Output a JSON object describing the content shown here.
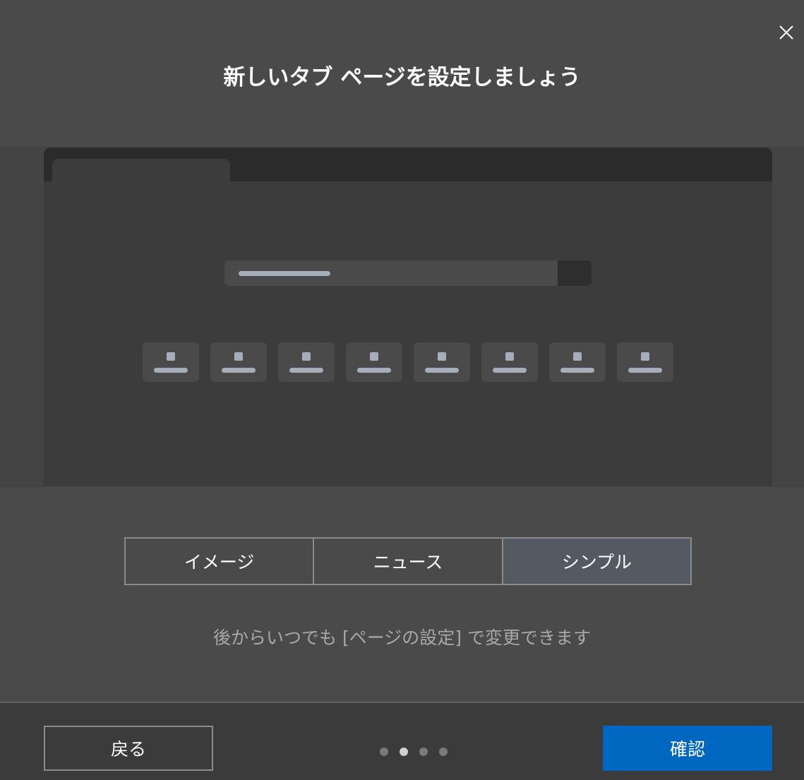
{
  "dialog": {
    "title": "新しいタブ ページを設定しましょう",
    "close_icon": "close-icon"
  },
  "preview": {
    "tile_count": 8
  },
  "layout_options": {
    "options": [
      {
        "label": "イメージ",
        "selected": false
      },
      {
        "label": "ニュース",
        "selected": false
      },
      {
        "label": "シンプル",
        "selected": true
      }
    ]
  },
  "hint": "後からいつでも [ページの設定] で変更できます",
  "footer": {
    "back_label": "戻る",
    "confirm_label": "確認",
    "pager": {
      "total": 4,
      "current": 2
    }
  },
  "colors": {
    "accent": "#0067c0",
    "selected_option": "#535a62",
    "background": "#4a4a4a"
  }
}
